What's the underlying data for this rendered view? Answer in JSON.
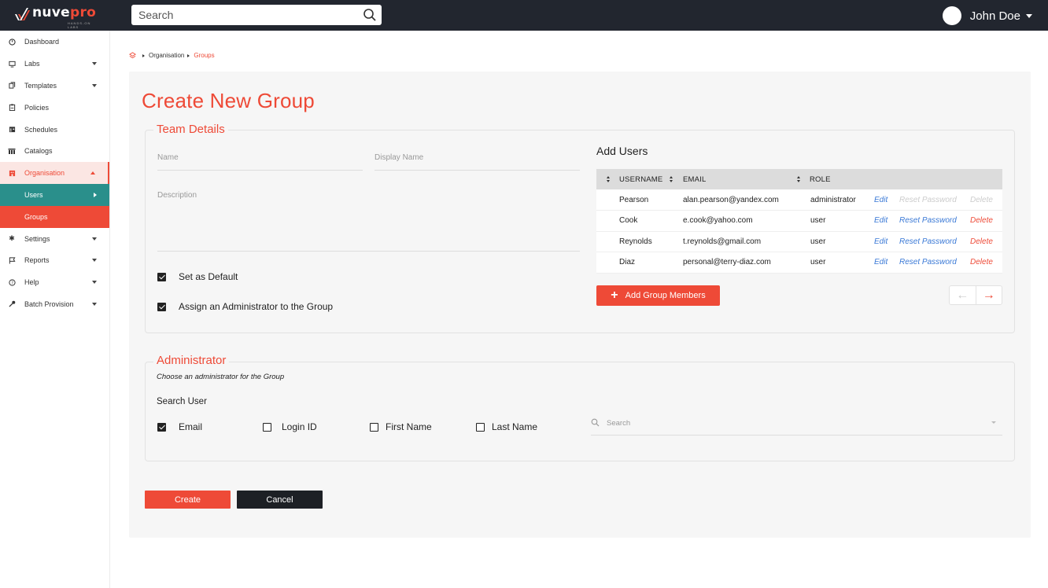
{
  "brand": {
    "name_main": "nuve",
    "name_accent": "pro",
    "tagline": "HANDS-ON LABS"
  },
  "topbar": {
    "search_placeholder": "Search",
    "user_name": "John Doe"
  },
  "sidebar": {
    "items": [
      {
        "label": "Dashboard",
        "icon": "dashboard-icon"
      },
      {
        "label": "Labs",
        "icon": "monitor-icon"
      },
      {
        "label": "Templates",
        "icon": "copy-icon"
      },
      {
        "label": "Policies",
        "icon": "clipboard-icon"
      },
      {
        "label": "Schedules",
        "icon": "calendar-icon"
      },
      {
        "label": "Catalogs",
        "icon": "columns-icon"
      },
      {
        "label": "Organisation",
        "icon": "building-icon"
      },
      {
        "label": "Users"
      },
      {
        "label": "Groups"
      },
      {
        "label": "Settings",
        "icon": "gear-icon"
      },
      {
        "label": "Reports",
        "icon": "flag-icon"
      },
      {
        "label": "Help",
        "icon": "help-icon"
      },
      {
        "label": "Batch Provision",
        "icon": "key-icon"
      }
    ]
  },
  "breadcrumb": {
    "level1": "Organisation",
    "current": "Groups"
  },
  "page_title": "Create New Group",
  "team": {
    "legend": "Team Details",
    "name_label": "Name",
    "display_name_label": "Display Name",
    "description_label": "Description",
    "set_default_label": "Set as Default",
    "set_default_checked": true,
    "assign_admin_label": "Assign an Administrator to the Group",
    "assign_admin_checked": true
  },
  "add_users": {
    "title": "Add Users",
    "columns": {
      "username": "USERNAME",
      "email": "EMAIL",
      "role": "ROLE"
    },
    "action_labels": {
      "edit": "Edit",
      "reset": "Reset Password",
      "delete": "Delete"
    },
    "rows": [
      {
        "username": "Pearson",
        "email": "alan.pearson@yandex.com",
        "role": "administrator"
      },
      {
        "username": "Cook",
        "email": "e.cook@yahoo.com",
        "role": "user"
      },
      {
        "username": "Reynolds",
        "email": "t.reynolds@gmail.com",
        "role": "user"
      },
      {
        "username": "Diaz",
        "email": "personal@terry-diaz.com",
        "role": "user"
      }
    ],
    "add_button": "Add Group Members"
  },
  "administrator": {
    "legend": "Administrator",
    "subtitle": "Choose an administrator for the Group",
    "search_user_label": "Search User",
    "options": {
      "email": "Email",
      "login_id": "Login ID",
      "first_name": "First Name",
      "last_name": "Last Name"
    },
    "email_checked": true,
    "search_placeholder": "Search"
  },
  "actions": {
    "create": "Create",
    "cancel": "Cancel"
  },
  "colors": {
    "accent": "#ee4a37",
    "teal": "#2a8f8b",
    "topbar": "#22262f",
    "dark_button": "#1d2025"
  }
}
